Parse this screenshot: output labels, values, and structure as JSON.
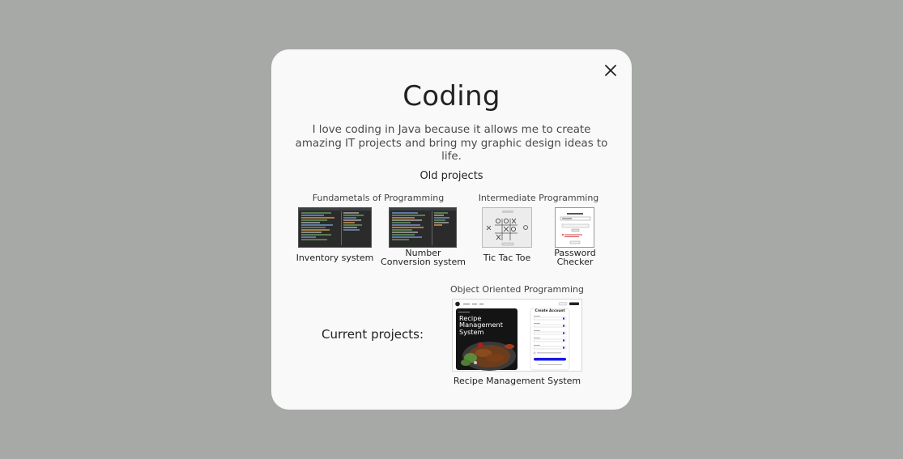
{
  "modal": {
    "title": "Coding",
    "description": "I love coding in Java because it allows me to create amazing IT projects and bring my graphic design ideas to life.",
    "close_icon": "close-icon"
  },
  "old_projects": {
    "heading": "Old projects",
    "groups": [
      {
        "label": "Fundametals of Programming",
        "projects": [
          {
            "label": "Inventory system"
          },
          {
            "label_line1": "Number",
            "label_line2": "Conversion system"
          }
        ]
      },
      {
        "label": "Intermediate Programming",
        "projects": [
          {
            "label": "Tic Tac Toe"
          },
          {
            "label_line1": "Password",
            "label_line2": "Checker"
          }
        ]
      }
    ]
  },
  "current_projects": {
    "heading": "Current projects:",
    "group_label": "Object Oriented Programming",
    "project": {
      "label": "Recipe Management System",
      "hero_line1": "Recipe",
      "hero_line2": "Management",
      "hero_line3": "System",
      "form_title": "Create Account"
    }
  },
  "colors": {
    "backdrop": "#a7a9a7",
    "modal_bg": "#f9f9f9",
    "accent_blue": "#1a1ae6"
  }
}
